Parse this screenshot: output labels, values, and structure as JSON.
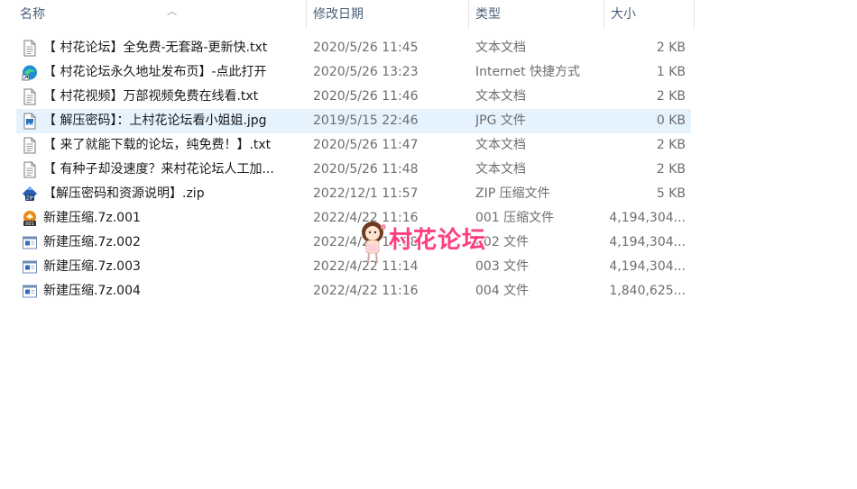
{
  "columns": {
    "name": "名称",
    "date": "修改日期",
    "type": "类型",
    "size": "大小"
  },
  "files": [
    {
      "name": "【 村花论坛】全免费-无套路-更新快.txt",
      "date": "2020/5/26 11:45",
      "type": "文本文档",
      "size": "2 KB",
      "icon": "text-file-icon"
    },
    {
      "name": "【 村花论坛永久地址发布页】-点此打开",
      "date": "2020/5/26 13:23",
      "type": "Internet 快捷方式",
      "size": "1 KB",
      "icon": "internet-shortcut-icon"
    },
    {
      "name": "【 村花视频】万部视频免费在线看.txt",
      "date": "2020/5/26 11:46",
      "type": "文本文档",
      "size": "2 KB",
      "icon": "text-file-icon"
    },
    {
      "name": "【 解压密码】：上村花论坛看小姐姐.jpg",
      "date": "2019/5/15 22:46",
      "type": "JPG 文件",
      "size": "0 KB",
      "icon": "image-file-icon"
    },
    {
      "name": "【 来了就能下载的论坛，纯免费！】.txt",
      "date": "2020/5/26 11:47",
      "type": "文本文档",
      "size": "2 KB",
      "icon": "text-file-icon"
    },
    {
      "name": "【 有种子却没速度？来村花论坛人工加...",
      "date": "2020/5/26 11:48",
      "type": "文本文档",
      "size": "2 KB",
      "icon": "text-file-icon"
    },
    {
      "name": "【解压密码和资源说明】.zip",
      "date": "2022/12/1 11:57",
      "type": "ZIP 压缩文件",
      "size": "5 KB",
      "icon": "zip-archive-icon"
    },
    {
      "name": "新建压缩.7z.001",
      "date": "2022/4/22 11:16",
      "type": "001 压缩文件",
      "size": "4,194,304...",
      "icon": "archive-001-icon"
    },
    {
      "name": "新建压缩.7z.002",
      "date": "2022/4/22 11:08",
      "type": "002 文件",
      "size": "4,194,304...",
      "icon": "generic-file-icon"
    },
    {
      "name": "新建压缩.7z.003",
      "date": "2022/4/22 11:14",
      "type": "003 文件",
      "size": "4,194,304...",
      "icon": "generic-file-icon"
    },
    {
      "name": "新建压缩.7z.004",
      "date": "2022/4/22 11:16",
      "type": "004 文件",
      "size": "1,840,625...",
      "icon": "generic-file-icon"
    }
  ],
  "selected_index": 3,
  "watermark": {
    "text": "村花论坛",
    "color": "#ff3f80"
  },
  "colors": {
    "selection": "#e5f3ff",
    "header_text": "#4c607a"
  }
}
